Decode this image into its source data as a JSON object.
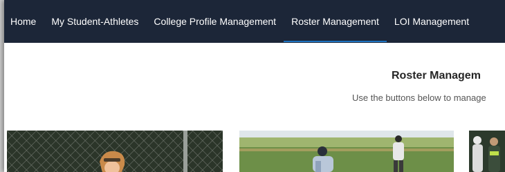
{
  "nav": {
    "items": [
      {
        "label": "Home"
      },
      {
        "label": "My Student-Athletes"
      },
      {
        "label": "College Profile Management"
      },
      {
        "label": "Roster Management",
        "active": true
      },
      {
        "label": "LOI Management"
      }
    ]
  },
  "main": {
    "title": "Roster Managem",
    "subtitle": "Use the buttons below to manage"
  },
  "colors": {
    "nav_background": "#1c2638",
    "active_underline": "#1f74c2"
  }
}
